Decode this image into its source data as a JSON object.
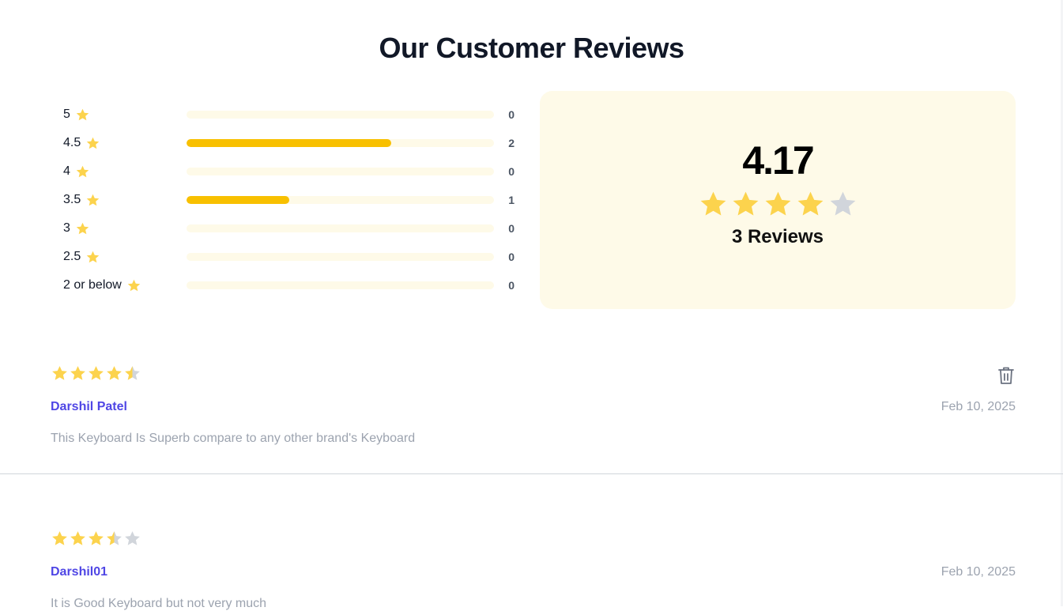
{
  "page": {
    "title": "Our Customer Reviews"
  },
  "colors": {
    "star": "#fcd34d",
    "star_empty": "#d1d5db",
    "bar": "#f8c000",
    "accent": "#4f46e5"
  },
  "breakdown": [
    {
      "label": "5",
      "count": "0",
      "fraction": 0
    },
    {
      "label": "4.5",
      "count": "2",
      "fraction": 0.667
    },
    {
      "label": "4",
      "count": "0",
      "fraction": 0
    },
    {
      "label": "3.5",
      "count": "1",
      "fraction": 0.333
    },
    {
      "label": "3",
      "count": "0",
      "fraction": 0
    },
    {
      "label": "2.5",
      "count": "0",
      "fraction": 0
    },
    {
      "label": "2 or below",
      "count": "0",
      "fraction": 0
    }
  ],
  "summary": {
    "average": "4.17",
    "rating": 4,
    "reviews_label": "3 Reviews"
  },
  "reviews": [
    {
      "rating": 4.5,
      "name": "Darshil Patel",
      "date": "Feb 10, 2025",
      "comment": "This Keyboard Is Superb compare to any other brand's Keyboard"
    },
    {
      "rating": 3.5,
      "name": "Darshil01",
      "date": "Feb 10, 2025",
      "comment": "It is Good Keyboard but not very much"
    }
  ]
}
